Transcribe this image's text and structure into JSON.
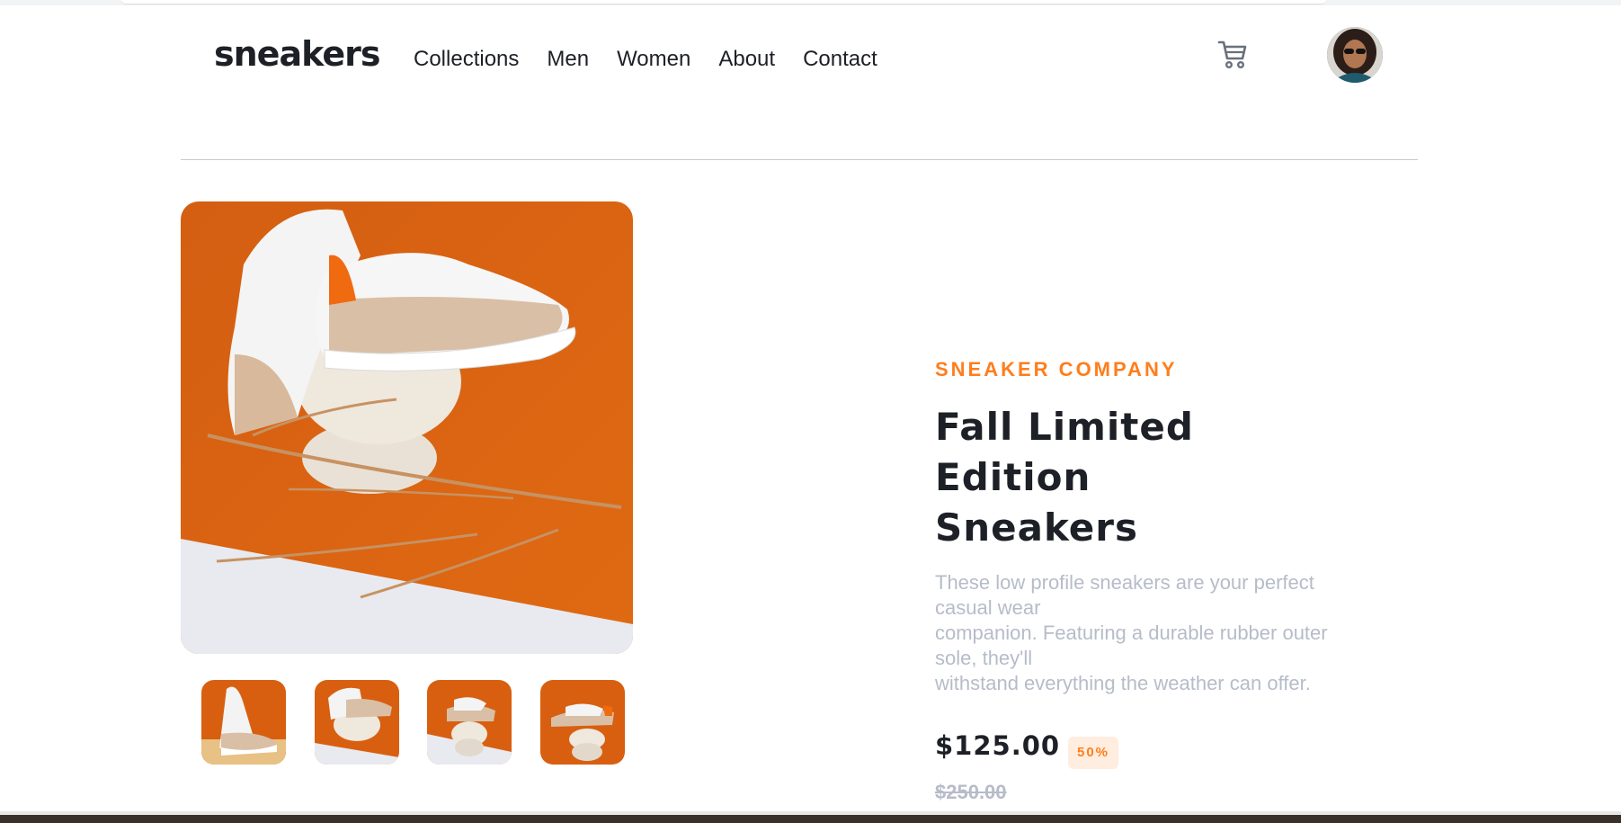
{
  "header": {
    "logo": "sneakers",
    "nav": [
      "Collections",
      "Men",
      "Women",
      "About",
      "Contact"
    ],
    "cart_icon": "cart-icon",
    "avatar_icon": "user-avatar"
  },
  "gallery": {
    "main_image": "sneakers-on-stones-main",
    "thumbnails": [
      "thumbnail-1",
      "thumbnail-2",
      "thumbnail-3",
      "thumbnail-4"
    ]
  },
  "product": {
    "company": "SNEAKER COMPANY",
    "title_lines": [
      "Fall Limited",
      "Edition",
      "Sneakers"
    ],
    "description": "These low profile sneakers are your perfect casual wear\ncompanion. Featuring a durable rubber outer sole, they'll\nwithstand everything the weather can offer.",
    "price": "$125.00",
    "discount": "50%",
    "original_price": "$250.00"
  },
  "colors": {
    "accent": "#ff7e1b",
    "accent_pale": "#ffede0",
    "text_dark": "#1d2026",
    "text_muted": "#b6bcc8"
  }
}
